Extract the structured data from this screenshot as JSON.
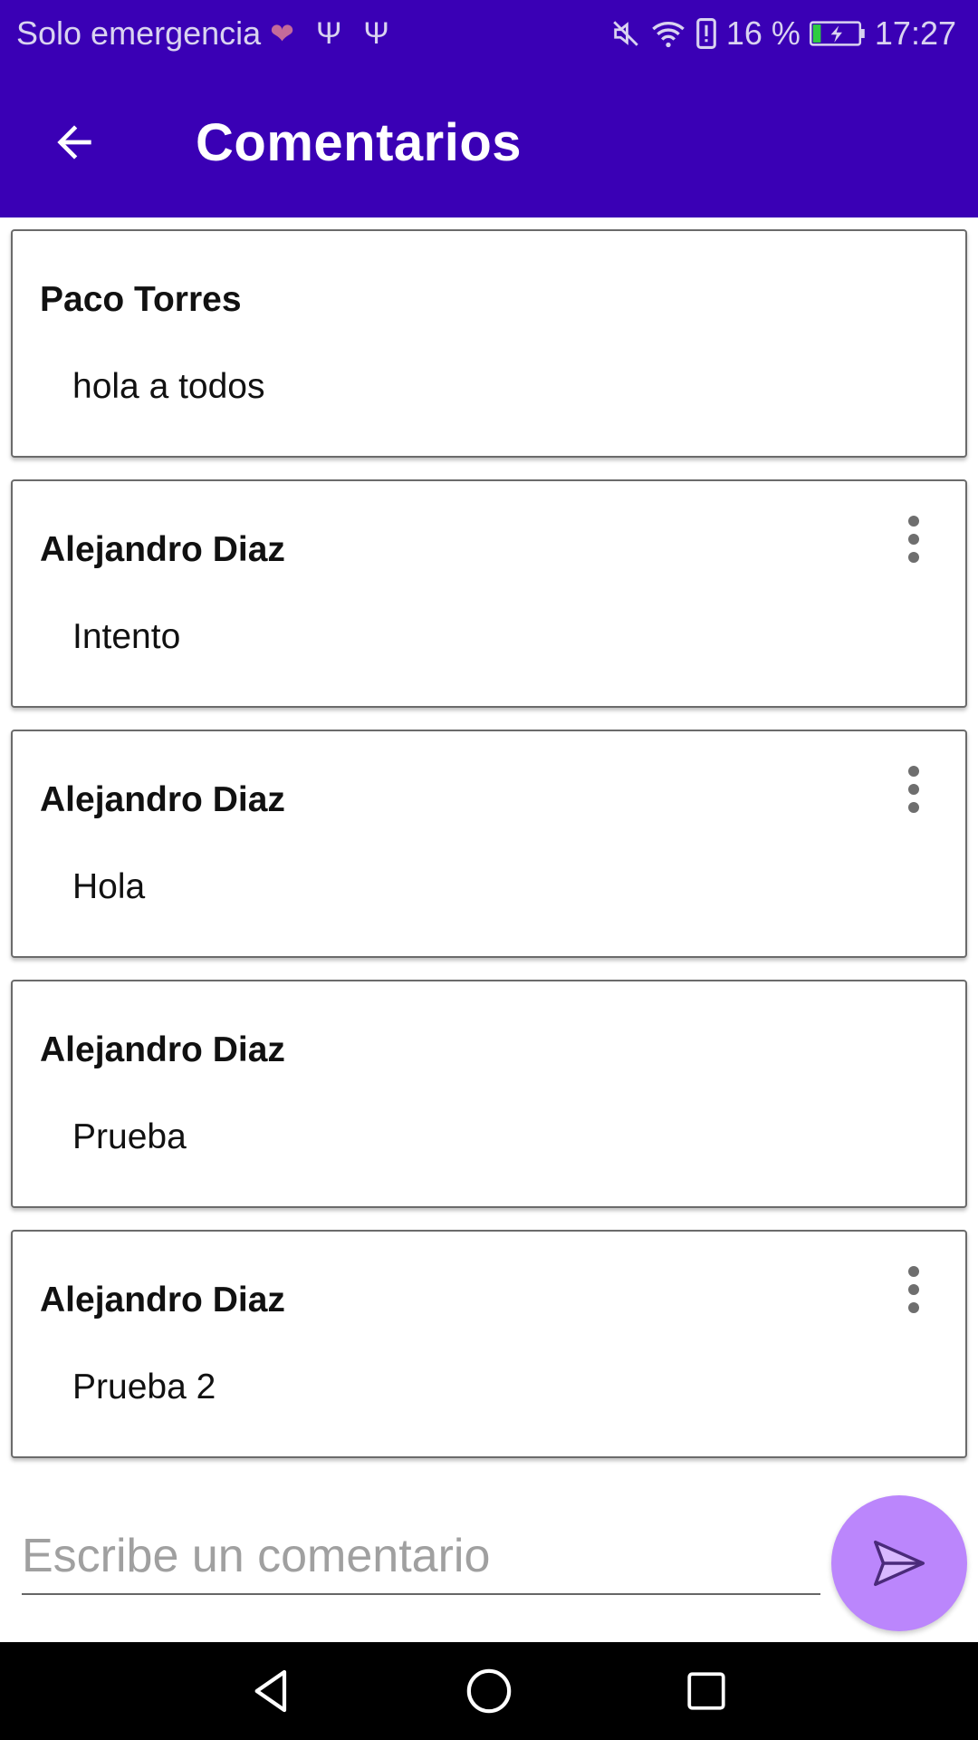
{
  "status_bar": {
    "carrier": "Solo emergencia",
    "battery": "16 %",
    "time": "17:27",
    "icons": [
      "heart-icon",
      "usb-icon",
      "usb-icon",
      "mute-icon",
      "wifi-icon",
      "alert-icon",
      "battery-charging-icon"
    ]
  },
  "app_bar": {
    "title": "Comentarios",
    "color": "#3a00b5",
    "back_icon": "arrow-back-icon"
  },
  "comments": [
    {
      "author": "Paco Torres",
      "text": "hola a todos",
      "has_menu": false
    },
    {
      "author": "Alejandro Diaz",
      "text": "Intento",
      "has_menu": true
    },
    {
      "author": "Alejandro Diaz",
      "text": "Hola",
      "has_menu": true
    },
    {
      "author": "Alejandro Diaz",
      "text": "Prueba",
      "has_menu": false
    },
    {
      "author": "Alejandro Diaz",
      "text": "Prueba 2",
      "has_menu": true
    }
  ],
  "composer": {
    "placeholder": "Escribe un comentario",
    "value": "",
    "send_icon": "send-icon",
    "send_color": "#bb86fc"
  },
  "nav_bar": {
    "icons": [
      "back-nav-icon",
      "home-nav-icon",
      "recents-nav-icon"
    ]
  }
}
